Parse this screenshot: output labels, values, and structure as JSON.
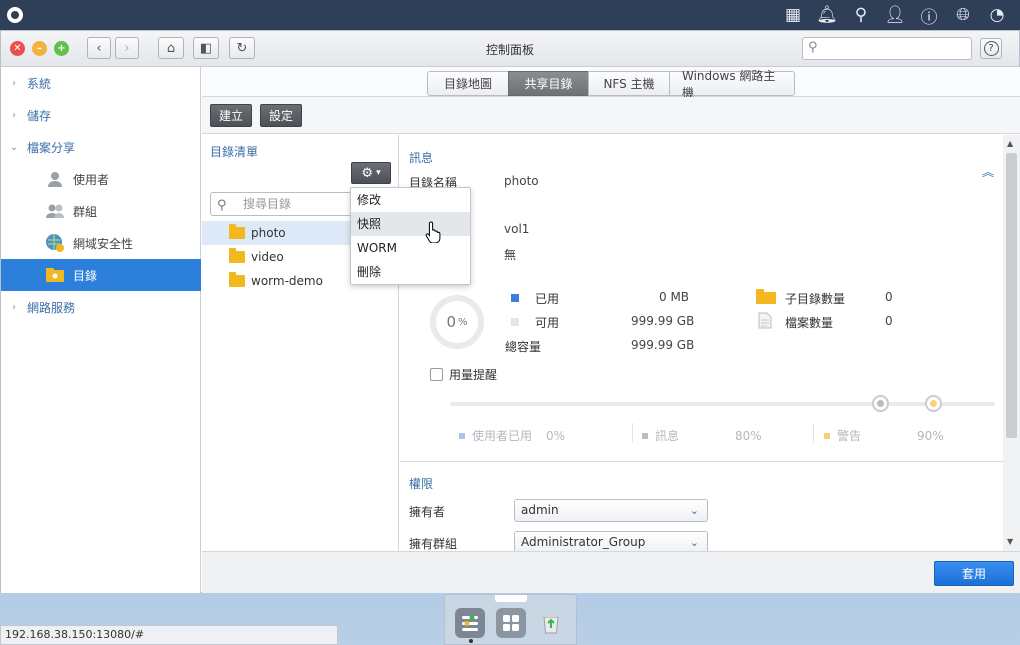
{
  "window": {
    "title": "控制面板"
  },
  "sidebar": {
    "items": [
      {
        "label": "系統"
      },
      {
        "label": "儲存"
      },
      {
        "label": "檔案分享"
      },
      {
        "label": "網路服務"
      }
    ],
    "sub_items": [
      {
        "label": "使用者"
      },
      {
        "label": "群組"
      },
      {
        "label": "網域安全性"
      },
      {
        "label": "目錄"
      }
    ]
  },
  "tabs": [
    "目錄地圖",
    "共享目錄",
    "NFS 主機",
    "Windows 網路主機"
  ],
  "toolbar": {
    "create_label": "建立",
    "settings_label": "設定"
  },
  "dir_list": {
    "title": "目錄清單",
    "search_placeholder": "搜尋目錄",
    "folders": [
      "photo",
      "video",
      "worm-demo"
    ]
  },
  "dropdown": {
    "items": [
      "修改",
      "快照",
      "WORM",
      "刪除"
    ]
  },
  "info": {
    "title": "訊息",
    "name_label": "目錄名稱",
    "name_value": "photo",
    "volume_value": "vol1",
    "desc_value": "無",
    "usage_percent": "0",
    "usage_unit": "%",
    "used_label": "已用",
    "used_value": "0 MB",
    "free_label": "可用",
    "free_value": "999.99 GB",
    "total_label": "總容量",
    "total_value": "999.99 GB",
    "subdir_label": "子目錄數量",
    "subdir_value": "0",
    "files_label": "檔案數量",
    "files_value": "0",
    "quota_alert_label": "用量提醒",
    "legend": [
      {
        "label": "使用者已用",
        "value": "0%",
        "color": "#aac6ec"
      },
      {
        "label": "訊息",
        "value": "80%",
        "color": "#b9bdc3"
      },
      {
        "label": "警告",
        "value": "90%",
        "color": "#f5d27a"
      }
    ],
    "slider": {
      "info_level": 0.8,
      "warn_level": 0.9
    }
  },
  "permissions": {
    "title": "權限",
    "owner_label": "擁有者",
    "owner_value": "admin",
    "group_label": "擁有群組",
    "group_value": "Administrator_Group"
  },
  "footer": {
    "apply_label": "套用"
  },
  "status_url": "192.168.38.150:13080/#",
  "colors": {
    "accent": "#2c7fdb",
    "topbar": "#2f3f58",
    "folder": "#f3b81f"
  }
}
